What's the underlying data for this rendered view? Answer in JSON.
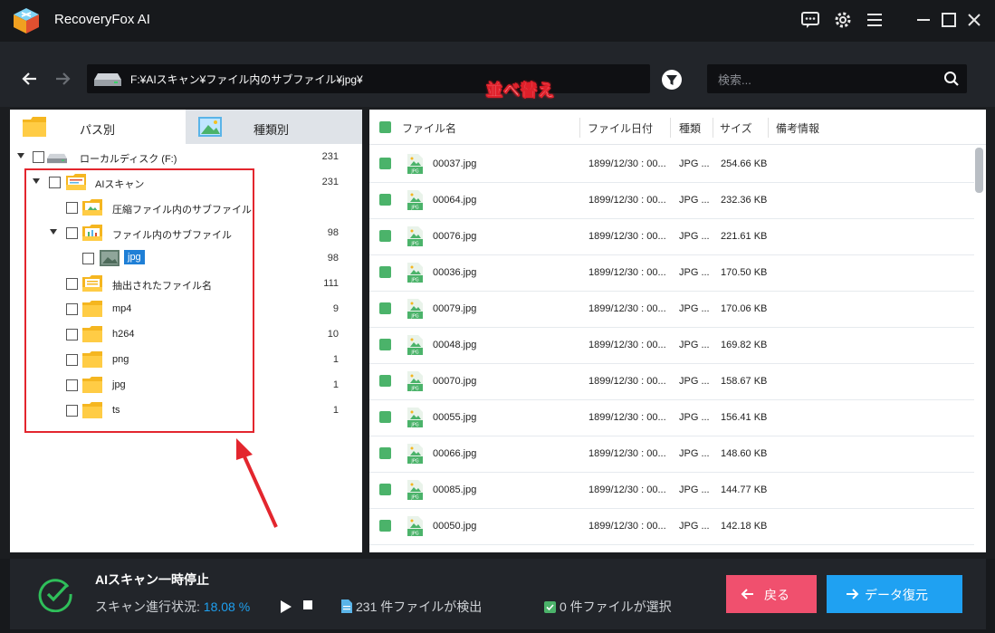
{
  "app": {
    "title": "RecoveryFox AI"
  },
  "toolbar": {
    "address": "F:¥AIスキャン¥ファイル内のサブファイル¥jpg¥",
    "search_placeholder": "検索..."
  },
  "annotation": {
    "label": "並べ替え"
  },
  "left_tabs": [
    {
      "label": "パス別"
    },
    {
      "label": "種類別"
    }
  ],
  "tree": [
    {
      "label": "ローカルディスク (F:)",
      "count": "231"
    },
    {
      "label": "AIスキャン",
      "count": "231"
    },
    {
      "label": "圧縮ファイル内のサブファイル",
      "count": ""
    },
    {
      "label": "ファイル内のサブファイル",
      "count": "98"
    },
    {
      "label": "jpg",
      "count": "98"
    },
    {
      "label": "抽出されたファイル名",
      "count": "111"
    },
    {
      "label": "mp4",
      "count": "9"
    },
    {
      "label": "h264",
      "count": "10"
    },
    {
      "label": "png",
      "count": "1"
    },
    {
      "label": "jpg",
      "count": "1"
    },
    {
      "label": "ts",
      "count": "1"
    }
  ],
  "table": {
    "headers": {
      "name": "ファイル名",
      "date": "ファイル日付",
      "type": "種類",
      "size": "サイズ",
      "note": "備考情報"
    },
    "rows": [
      {
        "name": "00037.jpg",
        "date": "1899/12/30 : 00...",
        "type": "JPG ...",
        "size": "254.66 KB"
      },
      {
        "name": "00064.jpg",
        "date": "1899/12/30 : 00...",
        "type": "JPG ...",
        "size": "232.36 KB"
      },
      {
        "name": "00076.jpg",
        "date": "1899/12/30 : 00...",
        "type": "JPG ...",
        "size": "221.61 KB"
      },
      {
        "name": "00036.jpg",
        "date": "1899/12/30 : 00...",
        "type": "JPG ...",
        "size": "170.50 KB"
      },
      {
        "name": "00079.jpg",
        "date": "1899/12/30 : 00...",
        "type": "JPG ...",
        "size": "170.06 KB"
      },
      {
        "name": "00048.jpg",
        "date": "1899/12/30 : 00...",
        "type": "JPG ...",
        "size": "169.82 KB"
      },
      {
        "name": "00070.jpg",
        "date": "1899/12/30 : 00...",
        "type": "JPG ...",
        "size": "158.67 KB"
      },
      {
        "name": "00055.jpg",
        "date": "1899/12/30 : 00...",
        "type": "JPG ...",
        "size": "156.41 KB"
      },
      {
        "name": "00066.jpg",
        "date": "1899/12/30 : 00...",
        "type": "JPG ...",
        "size": "148.60 KB"
      },
      {
        "name": "00085.jpg",
        "date": "1899/12/30 : 00...",
        "type": "JPG ...",
        "size": "144.77 KB"
      },
      {
        "name": "00050.jpg",
        "date": "1899/12/30 : 00...",
        "type": "JPG ...",
        "size": "142.18 KB"
      }
    ]
  },
  "status": {
    "title": "AIスキャン一時停止",
    "progress_label": "スキャン進行状況: ",
    "progress_value": "18.08 %",
    "found_text": "231 件ファイルが検出",
    "selected_text": "0 件ファイルが選択",
    "back_label": "戻る",
    "recover_label": "データ復元"
  },
  "colors": {
    "accent": "#1fa1f2",
    "back": "#f0506e",
    "annotation": "#e3262e",
    "checkbox_green": "#4bb36a"
  }
}
